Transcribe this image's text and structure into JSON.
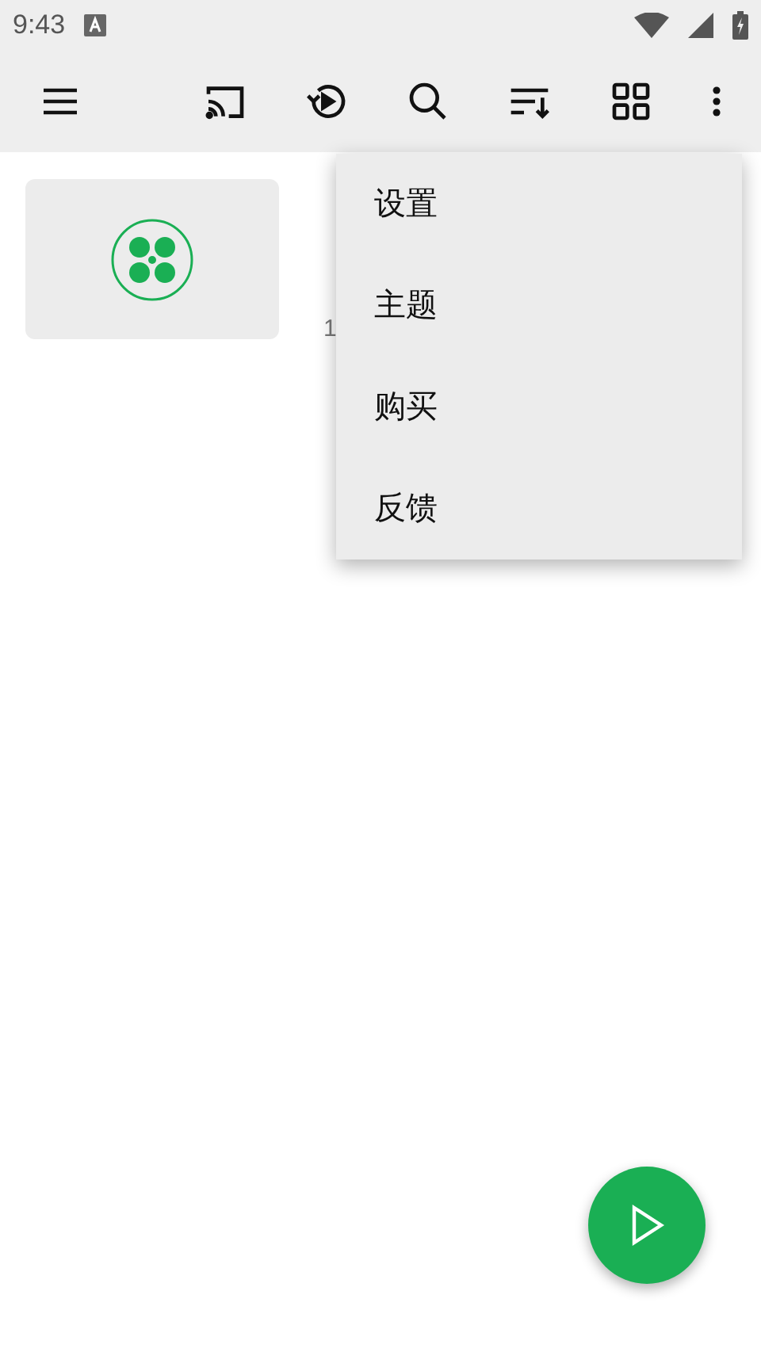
{
  "status_bar": {
    "time": "9:43"
  },
  "menu": {
    "items": [
      {
        "label": "设置"
      },
      {
        "label": "主题"
      },
      {
        "label": "购买"
      },
      {
        "label": "反馈"
      }
    ]
  },
  "folder": {
    "subtitle": "1"
  }
}
